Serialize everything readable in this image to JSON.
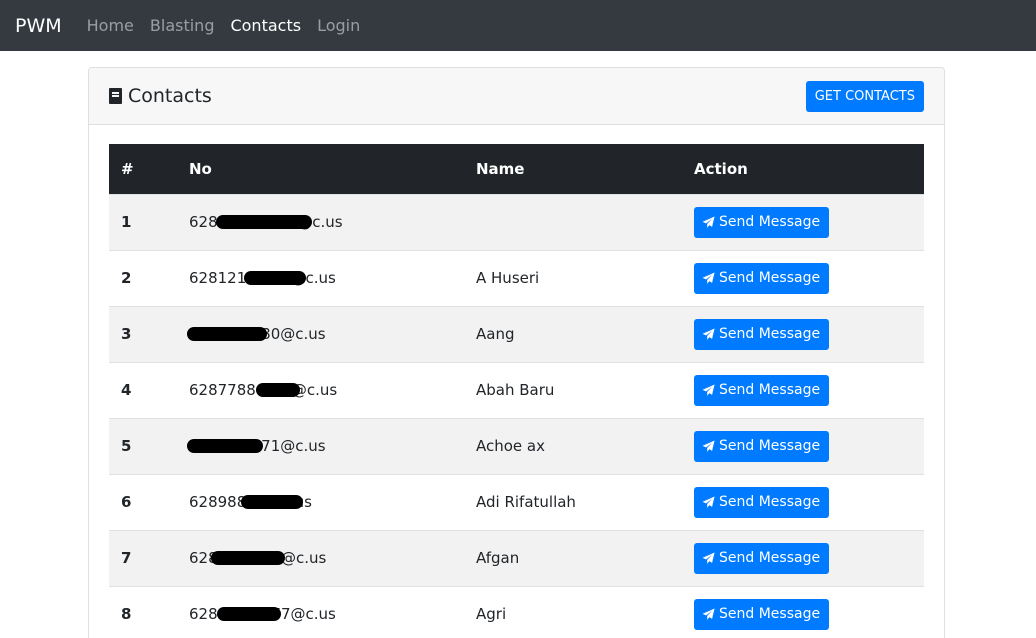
{
  "navbar": {
    "brand": "PWM",
    "links": [
      {
        "label": "Home",
        "active": false
      },
      {
        "label": "Blasting",
        "active": false
      },
      {
        "label": "Contacts",
        "active": true
      },
      {
        "label": "Login",
        "active": false
      }
    ]
  },
  "card": {
    "title": "Contacts",
    "title_icon": "book-icon",
    "get_button": "GET CONTACTS"
  },
  "table": {
    "headers": {
      "index": "#",
      "no": "No",
      "name": "Name",
      "action": "Action"
    },
    "action_label": "Send Message",
    "action_icon": "paper-plane-icon",
    "rows": [
      {
        "index": "1",
        "no": "628•••••••••@c.us",
        "name": ""
      },
      {
        "index": "2",
        "no": "628121•••••@c.us",
        "name": "A Huseri"
      },
      {
        "index": "3",
        "no": "••••••6580@c.us",
        "name": "Aang"
      },
      {
        "index": "4",
        "no": "62877880•••@c.us",
        "name": "Abah Baru"
      },
      {
        "index": "5",
        "no": "••••••2371@c.us",
        "name": "Achoe ax"
      },
      {
        "index": "6",
        "no": "628988••••c.us",
        "name": "Adi Rifatullah"
      },
      {
        "index": "7",
        "no": "628•••••71@c.us",
        "name": "Afgan"
      },
      {
        "index": "8",
        "no": "628•••••777@c.us",
        "name": "Agri"
      }
    ]
  },
  "colors": {
    "navbar_bg": "#343a40",
    "primary": "#007bff",
    "table_header_bg": "#212529",
    "stripe": "#f2f2f2"
  }
}
